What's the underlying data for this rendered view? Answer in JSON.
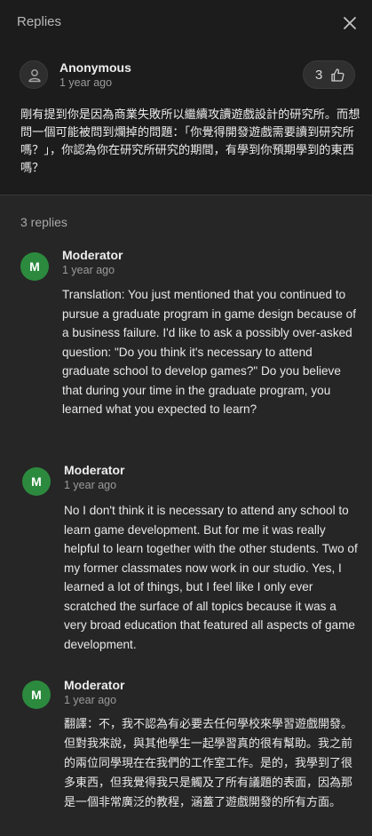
{
  "header": {
    "title": "Replies",
    "close_icon": "close-icon"
  },
  "question": {
    "author": "Anonymous",
    "time": "1 year ago",
    "likes": "3",
    "text": "剛有提到你是因為商業失敗所以繼續攻讀遊戲設計的研究所。而想問一個可能被問到爛掉的問題：「你覺得開發遊戲需要讀到研究所嗎？」，你認為你在研究所研究的期間，有學到你預期學到的東西嗎？"
  },
  "replies_count": "3 replies",
  "replies": [
    {
      "initial": "M",
      "author": "Moderator",
      "time": "1 year ago",
      "text": "Translation: You just mentioned that you continued to pursue a graduate program in game design because of a business failure. I'd like to ask a possibly over-asked question: \"Do you think it's necessary to attend graduate school to develop games?\" Do you believe that during your time in the graduate program, you learned what you expected to learn?"
    },
    {
      "initial": "M",
      "author": "Moderator",
      "time": "1 year ago",
      "text": "No I don't think it is necessary to attend any school to learn game development. But for me it was really helpful to learn together with the other students. Two of my former classmates now work in our studio. Yes, I learned a lot of things, but I feel like I only ever scratched the surface of all topics because it was a very broad education that featured all aspects of game development."
    },
    {
      "initial": "M",
      "author": "Moderator",
      "time": "1 year ago",
      "text": "翻譯：不，我不認為有必要去任何學校來學習遊戲開發。但對我來說，與其他學生一起學習真的很有幫助。我之前的兩位同學現在在我們的工作室工作。是的，我學到了很多東西，但我覺得我只是觸及了所有議題的表面，因為那是一個非常廣泛的教程，涵蓋了遊戲開發的所有方面。"
    }
  ],
  "colors": {
    "moderator_avatar": "#2c8a3e",
    "panel": "#1c1c1c",
    "background": "#262626"
  }
}
